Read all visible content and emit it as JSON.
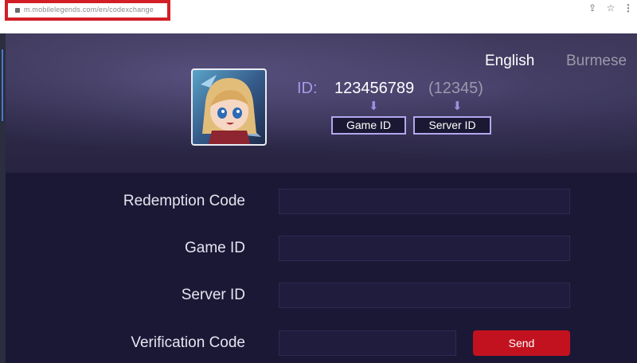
{
  "browser": {
    "url": "m.mobilelegends.com/en/codexchange"
  },
  "header": {
    "languages": [
      "English",
      "Burmese"
    ],
    "id_label": "ID:",
    "game_id_value": "123456789",
    "server_id_value": "(12345)",
    "game_id_tag": "Game ID",
    "server_id_tag": "Server ID",
    "arrow_glyph": "⬇"
  },
  "form": {
    "redemption_label": "Redemption Code",
    "game_id_label": "Game ID",
    "server_id_label": "Server ID",
    "verification_label": "Verification Code",
    "send_label": "Send"
  },
  "colors": {
    "accent_purple": "#a899e8",
    "send_red": "#c3121f",
    "url_highlight": "#d21f26"
  }
}
